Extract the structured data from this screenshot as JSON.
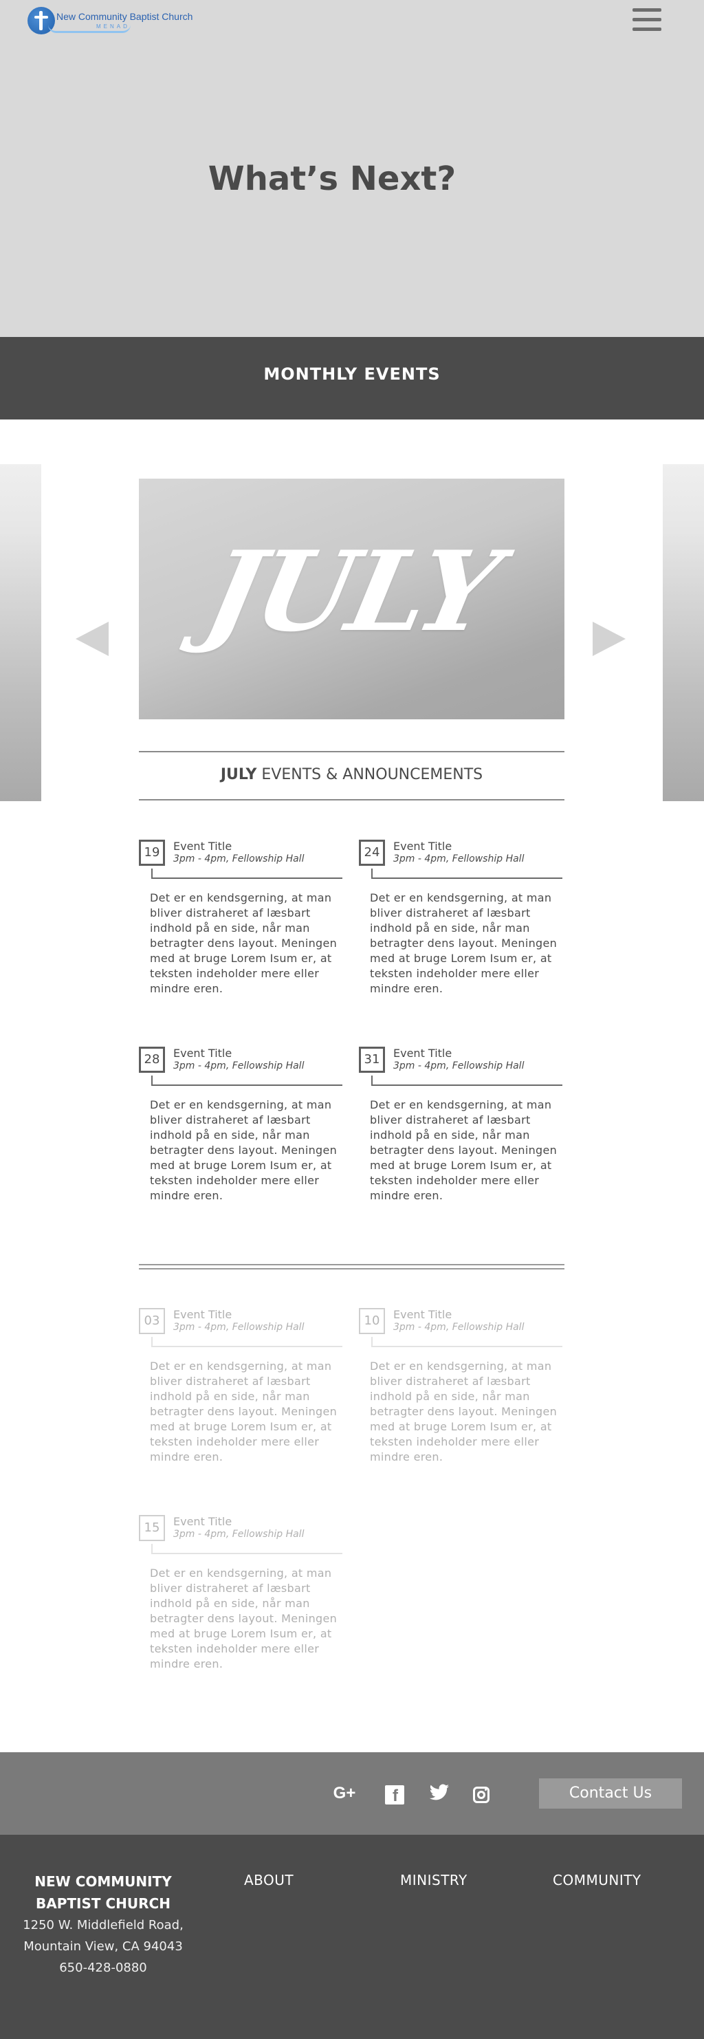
{
  "header": {
    "logo_text": "New Community Baptist Church",
    "logo_subtext": "MENAD",
    "menu_icon": "hamburger-icon"
  },
  "hero": {
    "title": "What’s Next?"
  },
  "section": {
    "title": "MONTHLY EVENTS"
  },
  "carousel": {
    "month": "JULY",
    "prev_icon": "triangle-left-icon",
    "next_icon": "triangle-right-icon"
  },
  "announcement": {
    "month": "JULY",
    "rest": " EVENTS & ANNOUNCEMENTS"
  },
  "events_current": [
    {
      "day": "19",
      "title": "Event Title",
      "time": "3pm - 4pm, Fellowship Hall",
      "body": "Det er en kendsgerning, at man bliver distraheret af læsbart indhold på en side, når man betragter dens layout. Meningen med at bruge Lorem Isum er, at teksten indeholder mere eller mindre eren."
    },
    {
      "day": "24",
      "title": "Event Title",
      "time": "3pm - 4pm, Fellowship Hall",
      "body": "Det er en kendsgerning, at man bliver distraheret af læsbart indhold på en side, når man betragter dens layout. Meningen med at bruge Lorem Isum er, at teksten indeholder mere eller mindre eren."
    },
    {
      "day": "28",
      "title": "Event Title",
      "time": "3pm - 4pm, Fellowship Hall",
      "body": "Det er en kendsgerning, at man bliver distraheret af læsbart indhold på en side, når man betragter dens layout. Meningen med at bruge Lorem Isum er, at teksten indeholder mere eller mindre eren."
    },
    {
      "day": "31",
      "title": "Event Title",
      "time": "3pm - 4pm, Fellowship Hall",
      "body": "Det er en kendsgerning, at man bliver distraheret af læsbart indhold på en side, når man betragter dens layout. Meningen med at bruge Lorem Isum er, at teksten indeholder mere eller mindre eren."
    }
  ],
  "events_next": [
    {
      "day": "03",
      "title": "Event Title",
      "time": "3pm - 4pm, Fellowship Hall",
      "body": "Det er en kendsgerning, at man bliver distraheret af læsbart indhold på en side, når man betragter dens layout. Meningen med at bruge Lorem Isum er, at teksten indeholder mere eller mindre eren."
    },
    {
      "day": "10",
      "title": "Event Title",
      "time": "3pm - 4pm, Fellowship Hall",
      "body": "Det er en kendsgerning, at man bliver distraheret af læsbart indhold på en side, når man betragter dens layout. Meningen med at bruge Lorem Isum er, at teksten indeholder mere eller mindre eren."
    },
    {
      "day": "15",
      "title": "Event Title",
      "time": "3pm - 4pm, Fellowship Hall",
      "body": "Det er en kendsgerning, at man bliver distraheret af læsbart indhold på en side, når man betragter dens layout. Meningen med at bruge Lorem Isum er, at teksten indeholder mere eller mindre eren."
    }
  ],
  "footer": {
    "social": {
      "gplus_label": "G+",
      "facebook_label": "f",
      "twitter_label": "🐦",
      "icons": [
        "google-plus-icon",
        "facebook-icon",
        "twitter-icon",
        "instagram-icon"
      ]
    },
    "contact_label": "Contact Us",
    "org_name_1": "NEW COMMUNITY",
    "org_name_2": "BAPTIST CHURCH",
    "address_1": "1250 W. Middlefield Road,",
    "address_2": "Mountain View, CA 94043",
    "phone": "650-428-0880",
    "links": [
      "ABOUT",
      "MINISTRY",
      "COMMUNITY"
    ]
  },
  "colors": {
    "hero_bg": "#d9d9d9",
    "band_bg": "#4b4b4b",
    "footer_top_bg": "#7a7a7a",
    "footer_bottom_bg": "#4b4b4b",
    "logo_blue": "#2b62b0"
  }
}
